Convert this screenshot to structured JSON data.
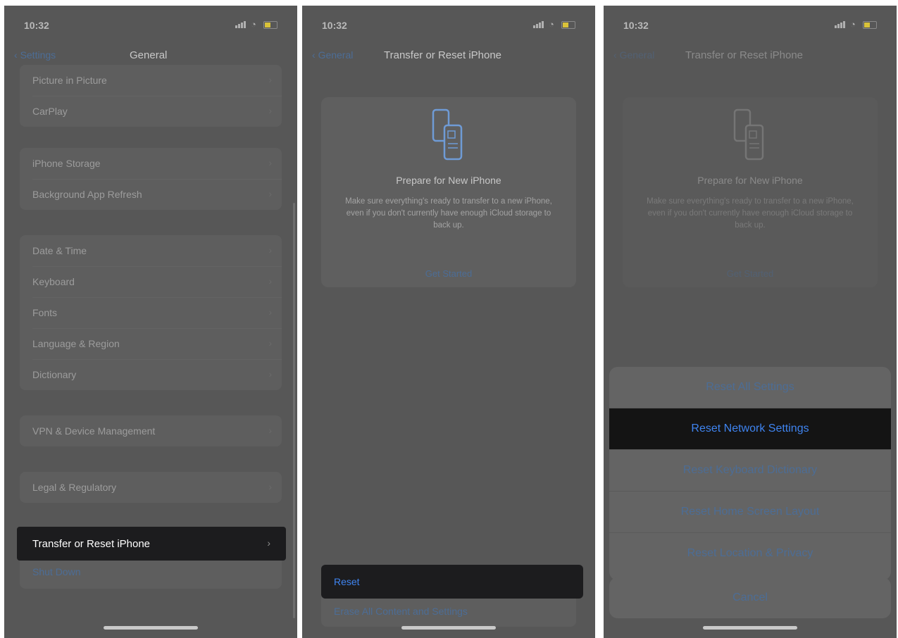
{
  "screen1": {
    "time": "10:32",
    "back_label": "Settings",
    "title": "General",
    "groups": [
      [
        "Picture in Picture",
        "CarPlay"
      ],
      [
        "iPhone Storage",
        "Background App Refresh"
      ],
      [
        "Date & Time",
        "Keyboard",
        "Fonts",
        "Language & Region",
        "Dictionary"
      ],
      [
        "VPN & Device Management"
      ],
      [
        "Legal & Regulatory"
      ]
    ],
    "selected_item": "Transfer or Reset iPhone",
    "below_item": "Shut Down"
  },
  "screen2": {
    "time": "10:32",
    "back_label": "General",
    "title": "Transfer or Reset iPhone",
    "card_title": "Prepare for New iPhone",
    "card_text": "Make sure everything's ready to transfer to a new iPhone, even if you don't currently have enough iCloud storage to back up.",
    "card_link": "Get Started",
    "reset_label": "Reset",
    "erase_label": "Erase All Content and Settings"
  },
  "screen3": {
    "time": "10:32",
    "back_label": "General",
    "title": "Transfer or Reset iPhone",
    "card_title": "Prepare for New iPhone",
    "card_text": "Make sure everything's ready to transfer to a new iPhone, even if you don't currently have enough iCloud storage to back up.",
    "card_link": "Get Started",
    "sheet_options": [
      "Reset All Settings",
      "Reset Network Settings",
      "Reset Keyboard Dictionary",
      "Reset Home Screen Layout",
      "Reset Location & Privacy"
    ],
    "selected_option": "Reset Network Settings",
    "cancel_label": "Cancel"
  },
  "colors": {
    "selected_row": "#1c1c1e",
    "link_blue": "#3f84f0",
    "dim_blue": "#4c6d96"
  }
}
